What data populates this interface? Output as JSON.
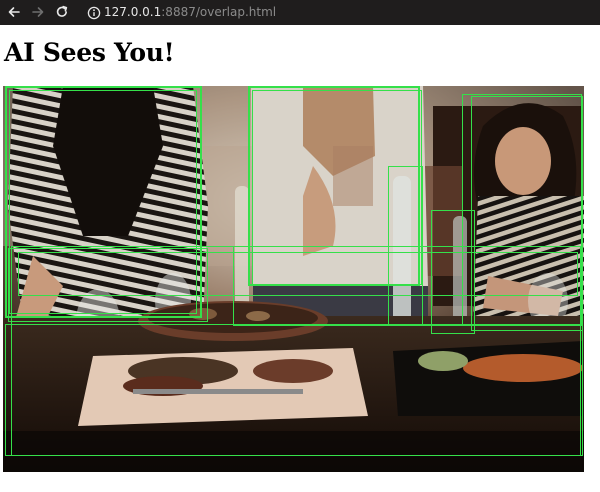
{
  "browser": {
    "url_host": "127.0.0.1",
    "url_rest": ":8887/overlap.html",
    "icons": {
      "back": "back-arrow-icon",
      "forward": "forward-arrow-icon",
      "reload": "reload-icon",
      "info": "info-icon"
    }
  },
  "page": {
    "title": "AI Sees You!"
  },
  "overlay": {
    "color": "#35e04a",
    "box_count": 13
  }
}
